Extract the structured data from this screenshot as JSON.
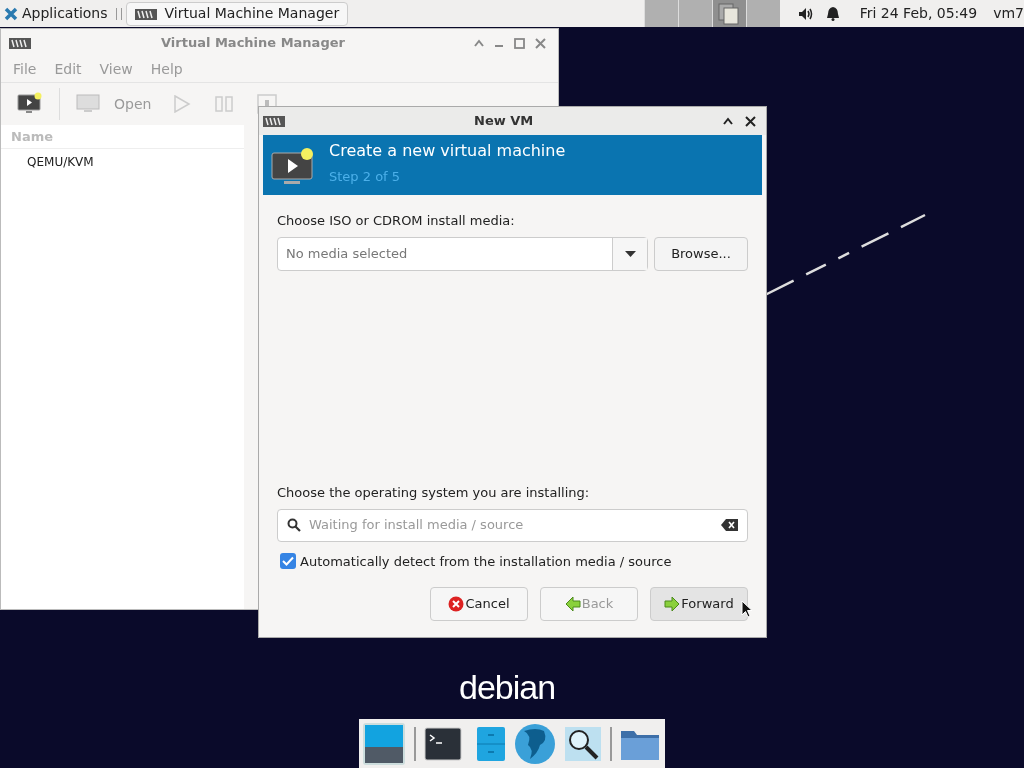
{
  "top_panel": {
    "applications": "Applications",
    "tasks": [
      {
        "title": "Virtual Machine Manager",
        "selected": true
      }
    ],
    "workspaces": [
      {
        "selected": false
      },
      {
        "selected": false
      },
      {
        "selected": true
      },
      {
        "selected": false
      }
    ],
    "clock": "Fri 24 Feb, 05:49",
    "user": "vm7"
  },
  "main_window": {
    "title": "Virtual Machine Manager",
    "menu": [
      "File",
      "Edit",
      "View",
      "Help"
    ],
    "open_label": "Open",
    "list_header": "Name",
    "connections": [
      "QEMU/KVM"
    ]
  },
  "dialog": {
    "title": "New VM",
    "header_title": "Create a new virtual machine",
    "header_step": "Step 2 of 5",
    "media_label": "Choose ISO or CDROM install media:",
    "media_placeholder": "No media selected",
    "browse": "Browse...",
    "os_label": "Choose the operating system you are installing:",
    "os_placeholder": "Waiting for install media / source",
    "auto_detect": {
      "label": "Automatically detect from the installation media / source",
      "checked": true
    },
    "buttons": [
      {
        "label": "Cancel",
        "kind": "cancel",
        "disabled": false
      },
      {
        "label": "Back",
        "kind": "back",
        "disabled": true
      },
      {
        "label": "Forward",
        "kind": "forward",
        "disabled": false
      }
    ]
  },
  "desktop": {
    "logo": "debian"
  }
}
